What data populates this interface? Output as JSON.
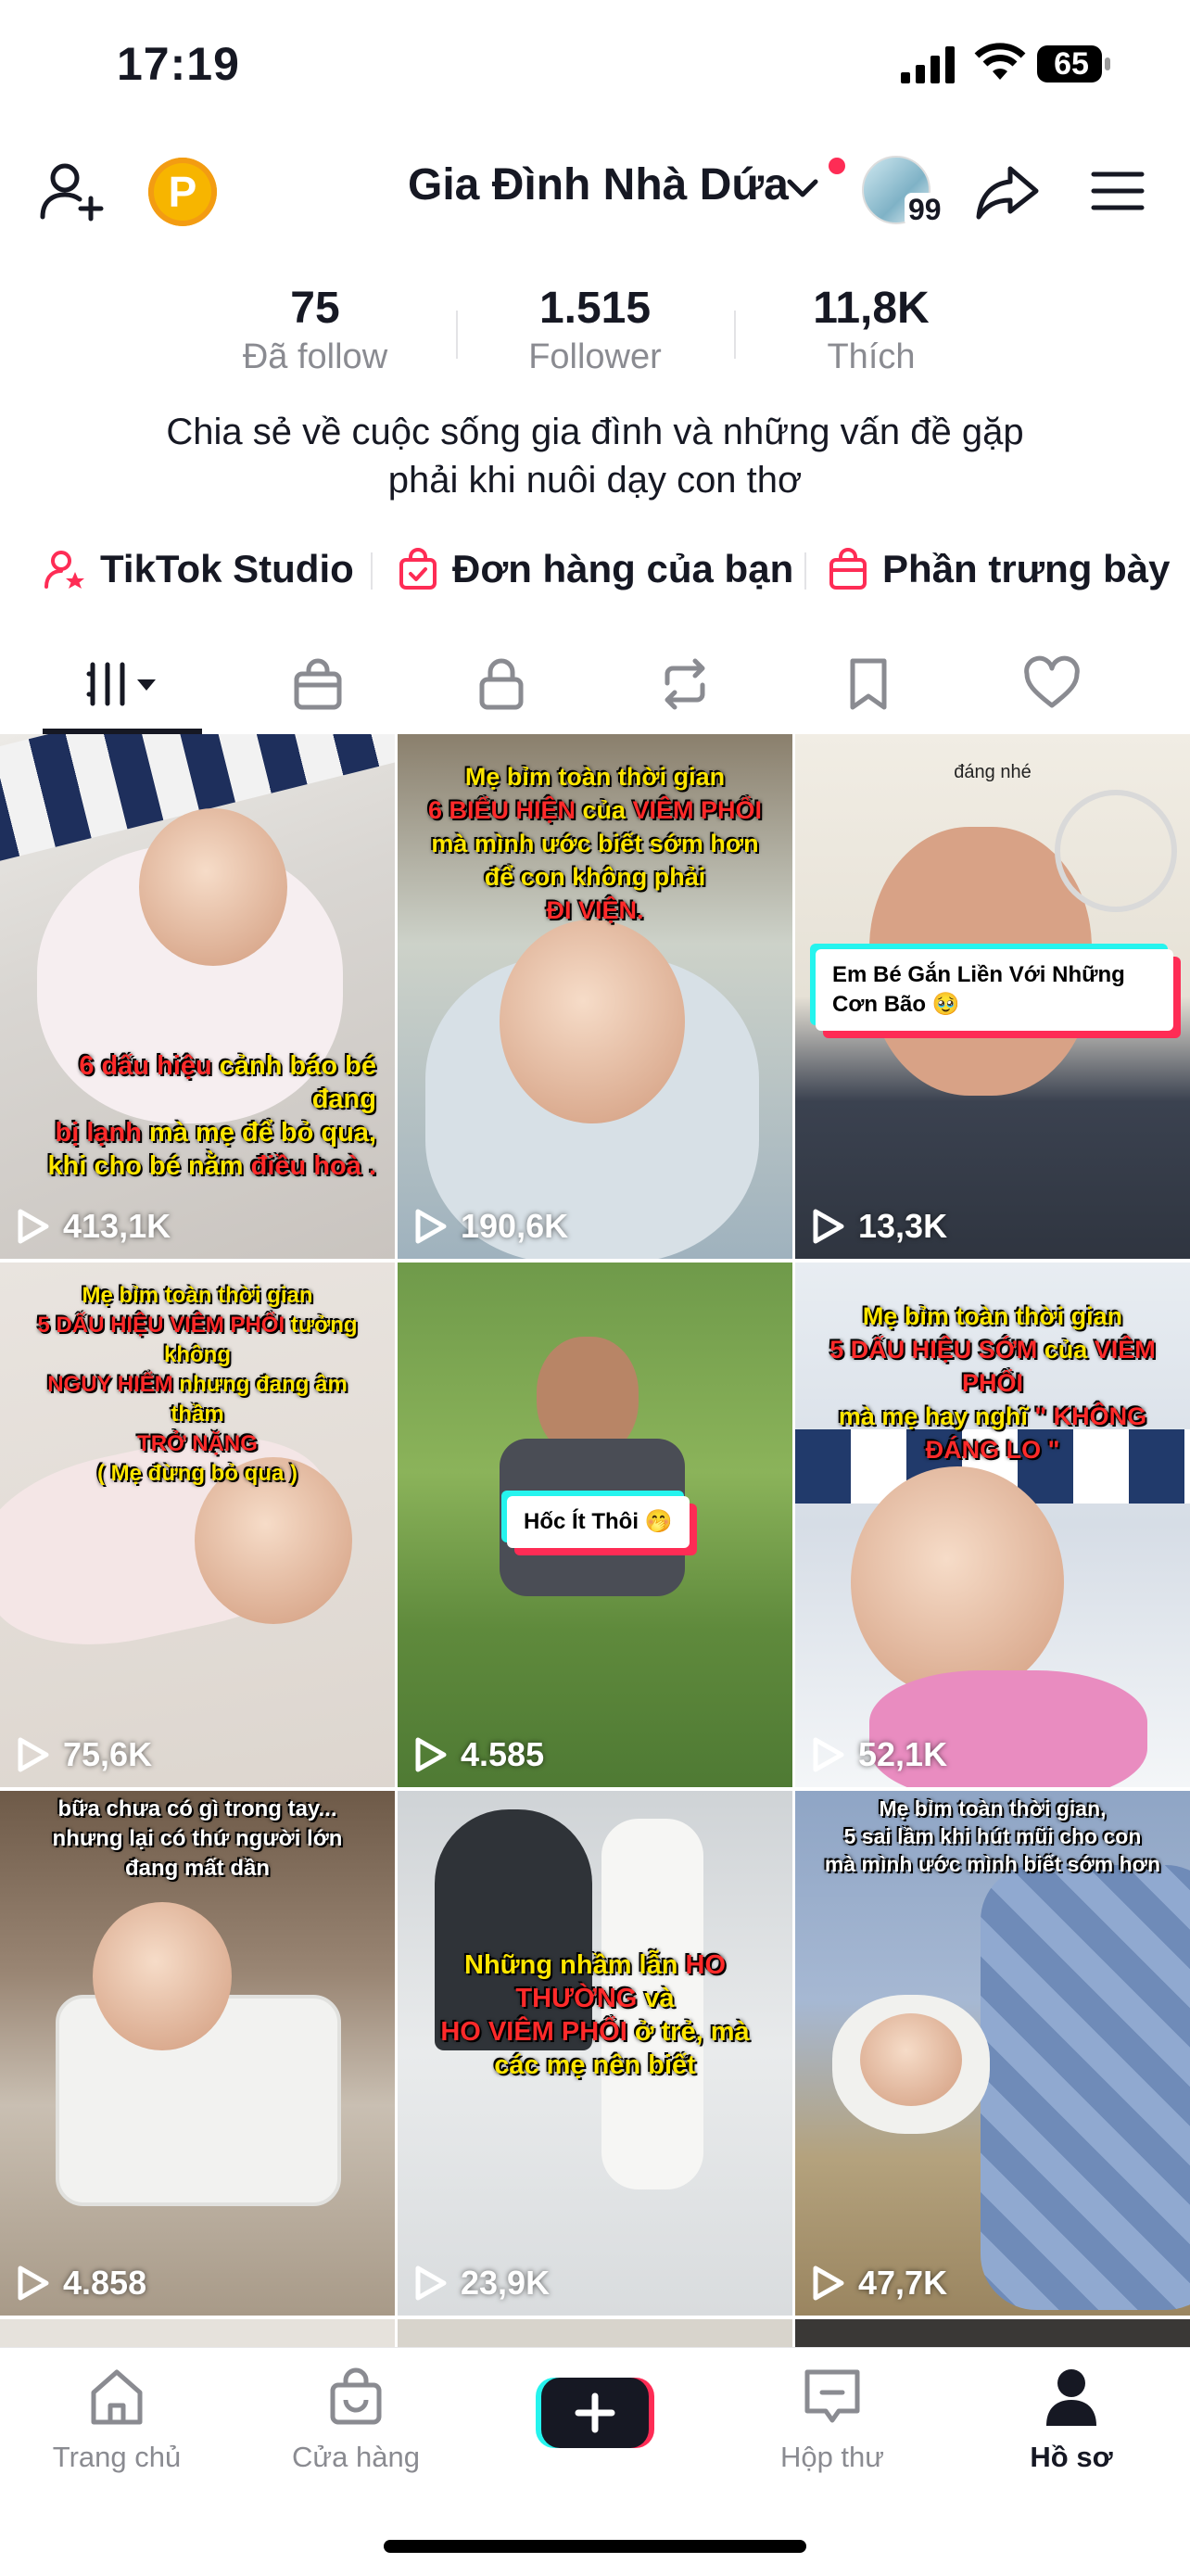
{
  "status_bar": {
    "time": "17:19",
    "battery": "65"
  },
  "header": {
    "username": "Gia Đình Nhà Dứa",
    "coin_label": "P",
    "friends_count": "99"
  },
  "stats": [
    {
      "value": "75",
      "label": "Đã follow"
    },
    {
      "value": "1.515",
      "label": "Follower"
    },
    {
      "value": "11,8K",
      "label": "Thích"
    }
  ],
  "bio": {
    "line1": "Chia sẻ về cuộc sống gia đình và những vấn đề gặp",
    "line2": "phải khi nuôi dạy con thơ"
  },
  "links": [
    {
      "label": "TikTok Studio"
    },
    {
      "label": "Đơn hàng của bạn"
    },
    {
      "label": "Phần trưng bày"
    }
  ],
  "tabs": [
    "videos-grid",
    "shop",
    "private",
    "reposts",
    "favorites",
    "liked"
  ],
  "videos": [
    {
      "views": "413,1K",
      "caption1": "6 dấu hiệu",
      "caption2": " cảnh báo bé đang",
      "caption3": "bị lạnh",
      "caption4": " mà mẹ để bỏ qua,",
      "caption5": "khi cho bé nằm ",
      "caption6": "điều hoà ."
    },
    {
      "views": "190,6K",
      "caption1": "Mẹ bỉm toàn thời gian",
      "caption2": "6 BIỂU HIỆN",
      "caption3": " của ",
      "caption4": "VIÊM PHỔI",
      "caption5": " mà mình ước biết sớm hơn để con không phải",
      "caption6": "ĐI VIỆN."
    },
    {
      "views": "13,3K",
      "top_text": "đáng nhé",
      "card": "Em Bé Gắn Liền Với Những Cơn Bão 🥹"
    },
    {
      "views": "75,6K",
      "caption1": "Mẹ bỉm toàn thời gian",
      "caption2": "5 DẤU HIỆU VIÊM PHỔI",
      "caption3": " tưởng không",
      "caption4": "NGUY HIỂM",
      "caption5": " nhưng đang âm thầm",
      "caption6": "TRỞ NẶNG",
      "caption7": "( Mẹ đừng bỏ qua )"
    },
    {
      "views": "4.585",
      "card": "Hốc Ít Thôi 🤭"
    },
    {
      "views": "52,1K",
      "caption1": "Mẹ bỉm toàn thời gian",
      "caption2": "5 DẤU HIỆU SỚM",
      "caption3": " của ",
      "caption4": "VIÊM PHỔI",
      "caption5": "mà mẹ hay nghĩ ",
      "caption6": "\" KHÔNG ĐÁNG LO \""
    },
    {
      "views": "4.858",
      "caption1": "bữa chưa có gì trong tay...",
      "caption2": "nhưng lại có thứ người lớn",
      "caption3": "đang mất dần"
    },
    {
      "views": "23,9K",
      "caption1": "Những nhầm lẫn ",
      "caption2": "HO THƯỜNG",
      "caption3": " và",
      "caption4": "HO VIÊM PHỔI",
      "caption5": " ở trẻ, mà các mẹ nên biết"
    },
    {
      "views": "47,7K",
      "caption1": "Mẹ bỉm toàn thời gian,",
      "caption2": "5 sai lầm khi hút mũi cho con",
      "caption3": "mà mình ước mình biết sớm hơn"
    }
  ],
  "nav": [
    {
      "label": "Trang chủ"
    },
    {
      "label": "Cửa hàng"
    },
    {
      "label": "Hộp thư"
    },
    {
      "label": "Hồ sơ"
    }
  ]
}
